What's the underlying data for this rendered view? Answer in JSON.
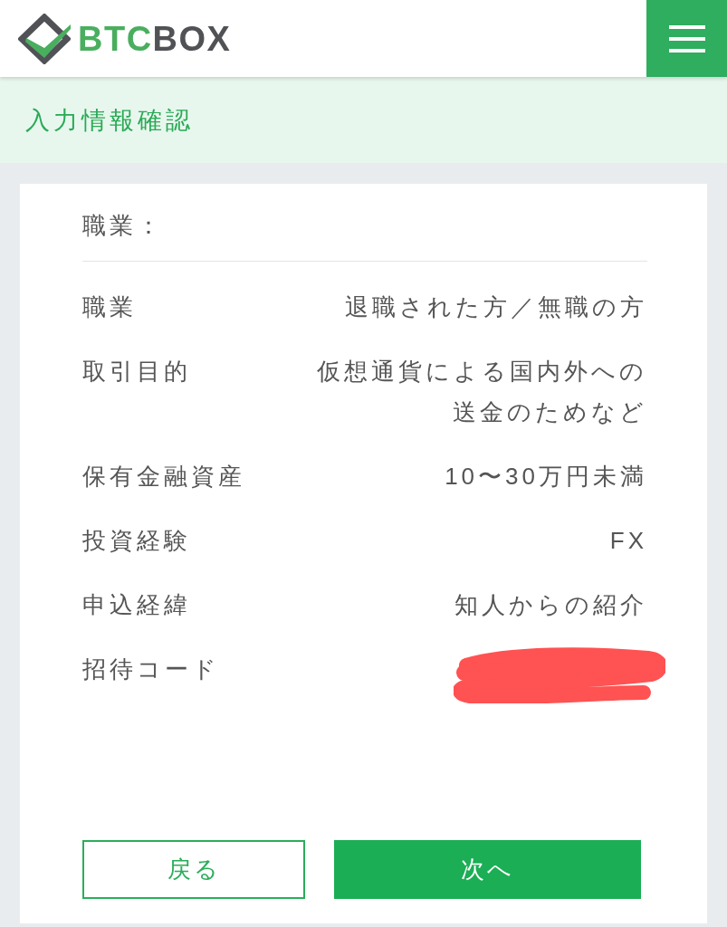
{
  "header": {
    "logo": {
      "parts": [
        {
          "text": "BTC",
          "color": "#4aae5f"
        },
        {
          "text": "BOX",
          "color": "#505256"
        }
      ]
    }
  },
  "page_title": "入力情報確認",
  "section": {
    "heading": "職業：",
    "rows": [
      {
        "label": "職業",
        "value": "退職された方／無職の方",
        "redacted": false
      },
      {
        "label": "取引目的",
        "value": "仮想通貨による国内外への送金のためなど",
        "redacted": false
      },
      {
        "label": "保有金融資産",
        "value": "10〜30万円未満",
        "redacted": false
      },
      {
        "label": "投資経験",
        "value": "FX",
        "redacted": false
      },
      {
        "label": "申込経緯",
        "value": "知人からの紹介",
        "redacted": false
      },
      {
        "label": "招待コード",
        "redacted": true
      }
    ]
  },
  "buttons": [
    {
      "label": "戻る",
      "kind": "secondary"
    },
    {
      "label": "次へ",
      "kind": "primary"
    }
  ]
}
